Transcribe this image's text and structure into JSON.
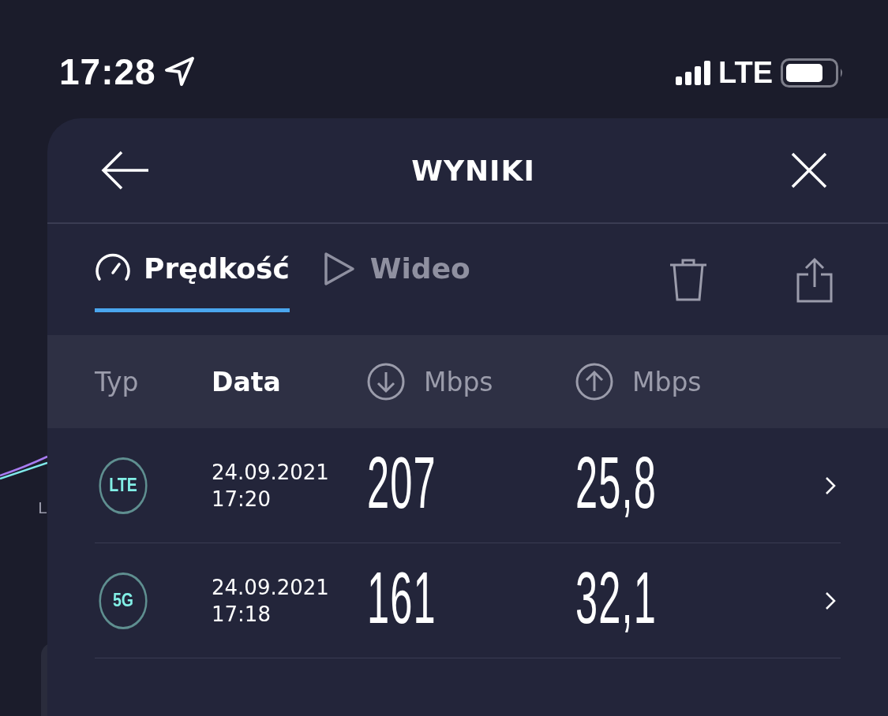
{
  "status_bar": {
    "time": "17:28",
    "network": "LTE"
  },
  "background": {
    "chart_label": "L"
  },
  "sheet": {
    "title": "WYNIKI"
  },
  "tabs": [
    {
      "label": "Prędkość",
      "kind": "speed",
      "selected": true
    },
    {
      "label": "Wideo",
      "kind": "video",
      "selected": false
    }
  ],
  "columns": [
    {
      "label": "Typ",
      "kind": "text",
      "selected": false
    },
    {
      "label": "Data",
      "kind": "text",
      "selected": true
    },
    {
      "label": "Mbps",
      "kind": "download",
      "selected": false
    },
    {
      "label": "Mbps",
      "kind": "upload",
      "selected": false
    }
  ],
  "rows": [
    {
      "type": "LTE",
      "date": "24.09.2021",
      "time": "17:20",
      "download": "207",
      "upload": "25,8"
    },
    {
      "type": "5G",
      "date": "24.09.2021",
      "time": "17:18",
      "download": "161",
      "upload": "32,1"
    }
  ]
}
